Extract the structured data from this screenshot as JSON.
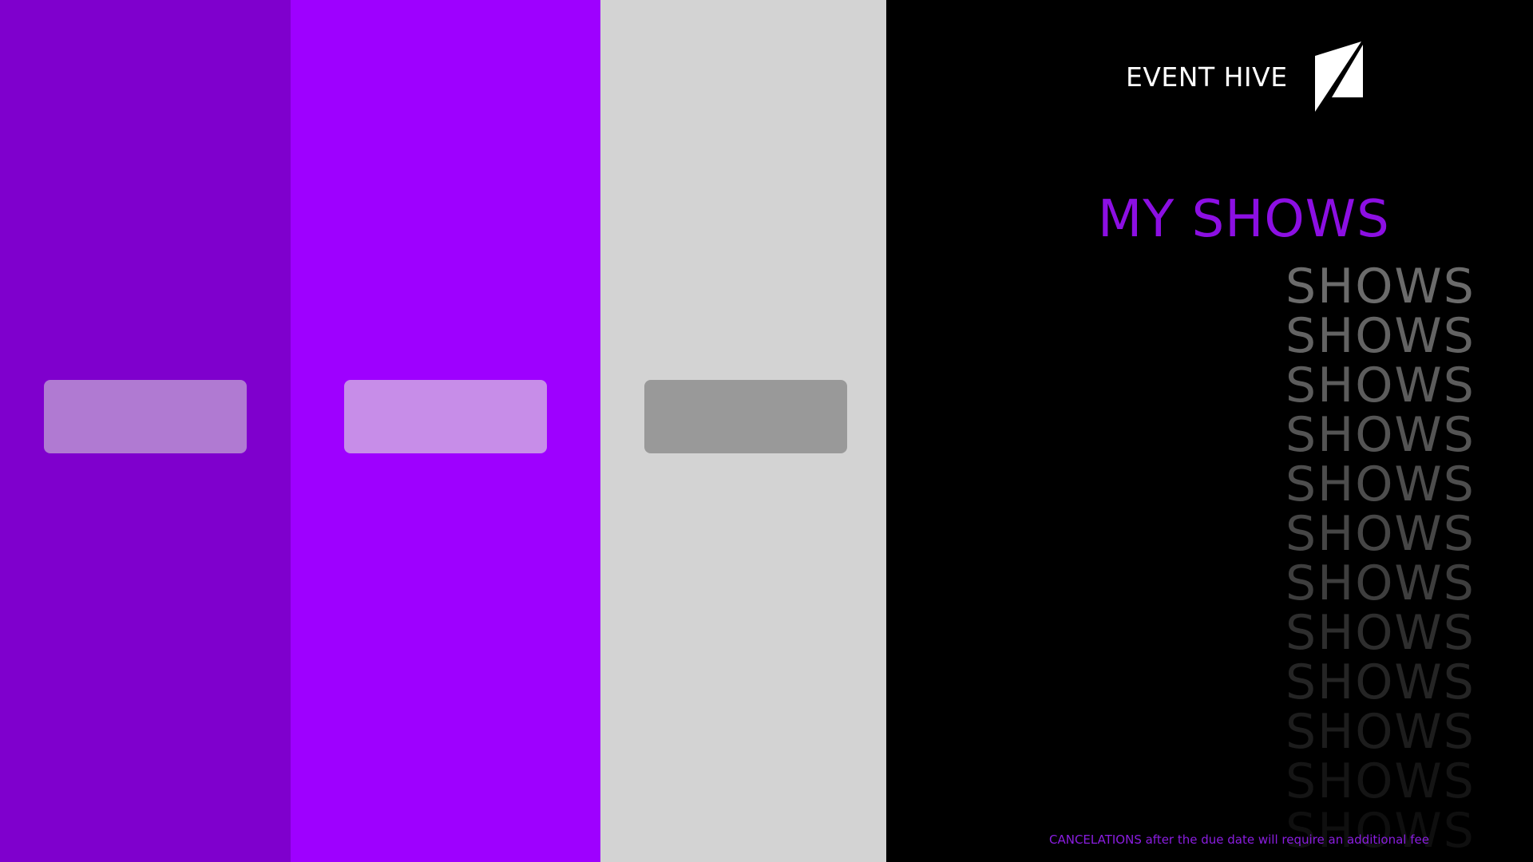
{
  "brand": {
    "name": "EVENT HIVE",
    "logo_icon": "slash-logo-icon"
  },
  "page": {
    "title": "MY SHOWS"
  },
  "echo": {
    "word": "SHOWS",
    "colors": [
      "#6b6b6b",
      "#636363",
      "#5c5c5c",
      "#545454",
      "#4d4d4d",
      "#464646",
      "#3e3e3e",
      "#2e2e2e",
      "#252525",
      "#1d1d1d",
      "#151515",
      "#0f0f0f"
    ]
  },
  "notice": {
    "text": "CANCELATIONS after the due date will require an additional fee"
  },
  "colors": {
    "panel_1": "#7f00cd",
    "panel_2": "#9e00ff",
    "panel_3": "#d3d3d3",
    "panel_4": "#000000",
    "accent": "#8c0fe3"
  }
}
